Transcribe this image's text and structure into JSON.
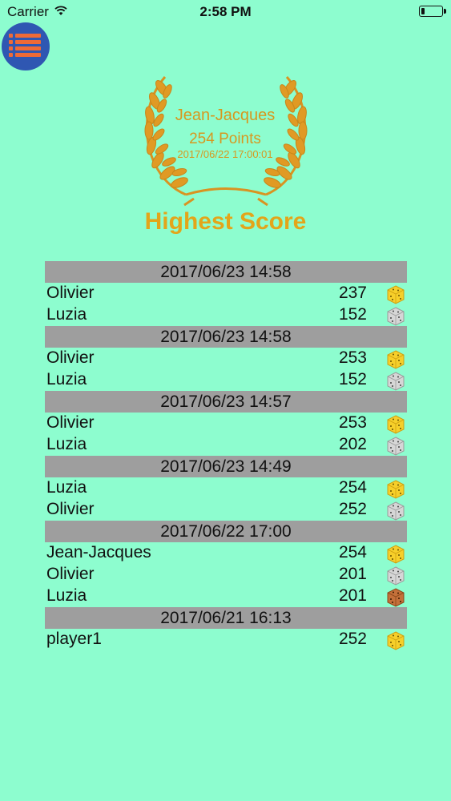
{
  "status_bar": {
    "carrier": "Carrier",
    "time": "2:58 PM"
  },
  "menu": {
    "icon": "list-menu-icon"
  },
  "highest": {
    "name": "Jean-Jacques",
    "points": "254 Points",
    "date": "2017/06/22 17:00:01",
    "title": "Highest Score"
  },
  "colors": {
    "background": "#8dfdcf",
    "header": "#9e9e9e",
    "gold": "#d7981f",
    "menu": "#2f57b2"
  },
  "games": [
    {
      "date": "2017/06/23 14:58",
      "players": [
        {
          "name": "Olivier",
          "score": "237",
          "die": "yellow"
        },
        {
          "name": "Luzia",
          "score": "152",
          "die": "gray"
        }
      ]
    },
    {
      "date": "2017/06/23 14:58",
      "players": [
        {
          "name": "Olivier",
          "score": "253",
          "die": "yellow"
        },
        {
          "name": "Luzia",
          "score": "152",
          "die": "gray"
        }
      ]
    },
    {
      "date": "2017/06/23 14:57",
      "players": [
        {
          "name": "Olivier",
          "score": "253",
          "die": "yellow"
        },
        {
          "name": "Luzia",
          "score": "202",
          "die": "gray"
        }
      ]
    },
    {
      "date": "2017/06/23 14:49",
      "players": [
        {
          "name": "Luzia",
          "score": "254",
          "die": "yellow"
        },
        {
          "name": "Olivier",
          "score": "252",
          "die": "gray"
        }
      ]
    },
    {
      "date": "2017/06/22 17:00",
      "players": [
        {
          "name": "Jean-Jacques",
          "score": "254",
          "die": "yellow"
        },
        {
          "name": "Olivier",
          "score": "201",
          "die": "gray"
        },
        {
          "name": "Luzia",
          "score": "201",
          "die": "brown"
        }
      ]
    },
    {
      "date": "2017/06/21 16:13",
      "players": [
        {
          "name": "player1",
          "score": "252",
          "die": "yellow"
        }
      ]
    }
  ]
}
